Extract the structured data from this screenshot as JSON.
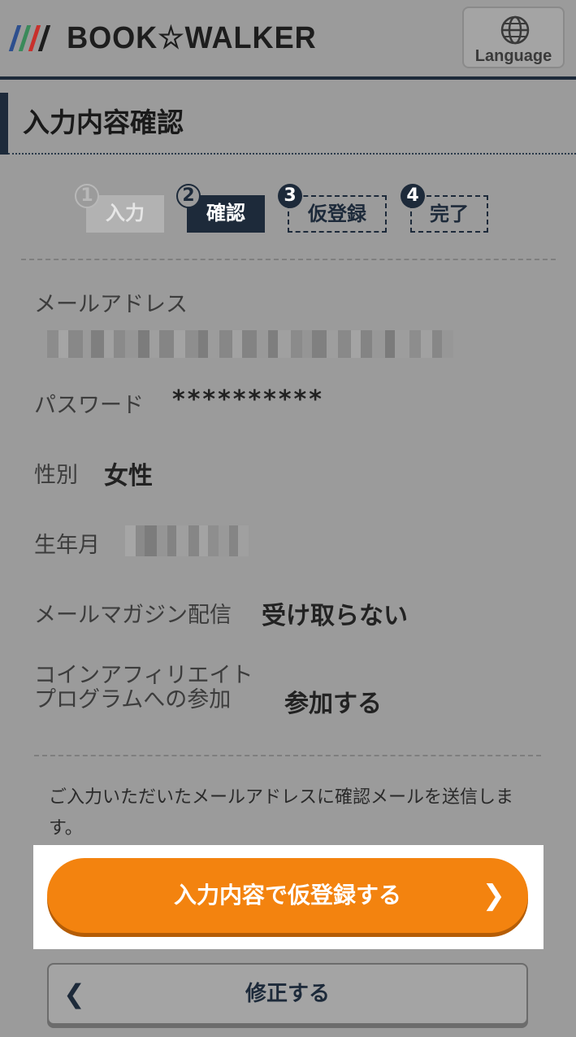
{
  "header": {
    "brand": "BOOK☆WALKER",
    "logo_stripe_colors": [
      "#2d4f8e",
      "#3a8a5a",
      "#c8302c",
      "#1d1d1d"
    ],
    "language_label": "Language",
    "language_icon": "globe-icon"
  },
  "page": {
    "title": "入力内容確認"
  },
  "steps": [
    {
      "num": "1",
      "label": "入力",
      "state": "done"
    },
    {
      "num": "2",
      "label": "確認",
      "state": "current"
    },
    {
      "num": "3",
      "label": "仮登録",
      "state": "upcoming"
    },
    {
      "num": "4",
      "label": "完了",
      "state": "upcoming"
    }
  ],
  "fields": {
    "email": {
      "label": "メールアドレス",
      "value_redacted": true
    },
    "password": {
      "label": "パスワード",
      "value": "**********"
    },
    "gender": {
      "label": "性別",
      "value": "女性"
    },
    "birth": {
      "label": "生年月",
      "value_redacted": true
    },
    "newsletter": {
      "label": "メールマガジン配信",
      "value": "受け取らない"
    },
    "affiliate": {
      "label_line1": "コインアフィリエイト",
      "label_line2": "プログラムへの参加",
      "value": "参加する"
    }
  },
  "note": "ご入力いただいたメールアドレスに確認メールを送信します。",
  "actions": {
    "primary_label": "入力内容で仮登録する",
    "primary_icon": "chevron-right-icon",
    "secondary_label": "修正する",
    "secondary_icon": "chevron-left-icon"
  },
  "colors": {
    "accent": "#f3830f",
    "navy": "#1d2a3a",
    "overlay_bg": "#9b9b9b",
    "highlight": "#ffffff"
  }
}
